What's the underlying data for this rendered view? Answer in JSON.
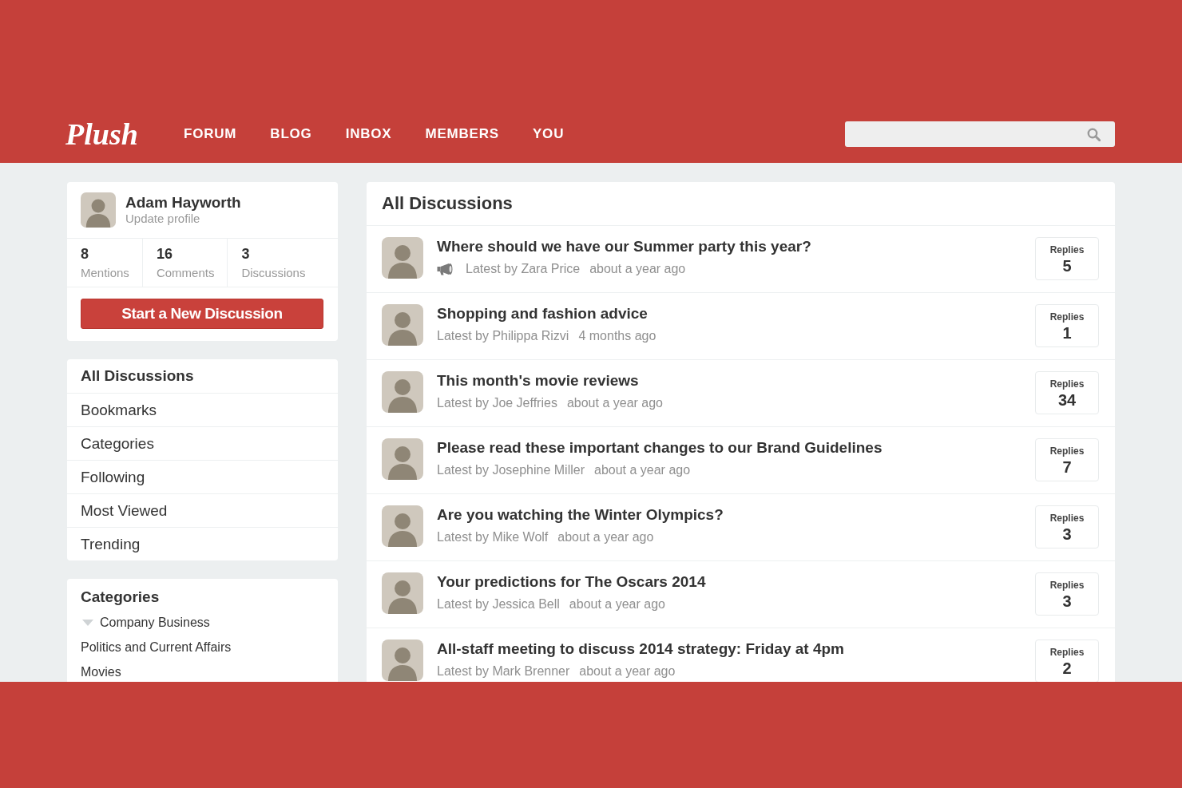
{
  "header": {
    "logo": "Plush",
    "nav": [
      "FORUM",
      "BLOG",
      "INBOX",
      "MEMBERS",
      "YOU"
    ]
  },
  "profile": {
    "name": "Adam Hayworth",
    "link": "Update profile",
    "stats": [
      {
        "value": "8",
        "label": "Mentions"
      },
      {
        "value": "16",
        "label": "Comments"
      },
      {
        "value": "3",
        "label": "Discussions"
      }
    ],
    "button": "Start a New Discussion"
  },
  "sidebar": {
    "items": [
      {
        "label": "All Discussions",
        "selected": true
      },
      {
        "label": "Bookmarks",
        "selected": false
      },
      {
        "label": "Categories",
        "selected": false
      },
      {
        "label": "Following",
        "selected": false
      },
      {
        "label": "Most Viewed",
        "selected": false
      },
      {
        "label": "Trending",
        "selected": false
      }
    ]
  },
  "categories": {
    "title": "Categories",
    "items": [
      {
        "kind": "group",
        "label": "Company Business",
        "expanded": true
      },
      {
        "kind": "item",
        "label": "Politics and Current Affairs"
      },
      {
        "kind": "item",
        "label": "Movies"
      }
    ]
  },
  "discussions": {
    "title": "All Discussions",
    "rows": [
      {
        "title": "Where should we have our Summer party this year?",
        "announcement": true,
        "latest": "Latest by Zara Price",
        "time": "about a year ago",
        "replies_label": "Replies",
        "replies": "5"
      },
      {
        "title": "Shopping and fashion advice",
        "announcement": false,
        "latest": "Latest by Philippa Rizvi",
        "time": "4 months ago",
        "replies_label": "Replies",
        "replies": "1"
      },
      {
        "title": "This month's movie reviews",
        "announcement": false,
        "latest": "Latest by Joe Jeffries",
        "time": "about a year ago",
        "replies_label": "Replies",
        "replies": "34"
      },
      {
        "title": "Please read these important changes to our Brand Guidelines",
        "announcement": false,
        "latest": "Latest by Josephine Miller",
        "time": "about a year ago",
        "replies_label": "Replies",
        "replies": "7"
      },
      {
        "title": "Are you watching the Winter Olympics?",
        "announcement": false,
        "latest": "Latest by Mike Wolf",
        "time": "about a year ago",
        "replies_label": "Replies",
        "replies": "3"
      },
      {
        "title": "Your predictions for The Oscars 2014",
        "announcement": false,
        "latest": "Latest by Jessica Bell",
        "time": "about a year ago",
        "replies_label": "Replies",
        "replies": "3"
      },
      {
        "title": "All-staff meeting to discuss 2014 strategy: Friday at 4pm",
        "announcement": false,
        "latest": "Latest by Mark Brenner",
        "time": "about a year ago",
        "replies_label": "Replies",
        "replies": "2"
      }
    ]
  }
}
